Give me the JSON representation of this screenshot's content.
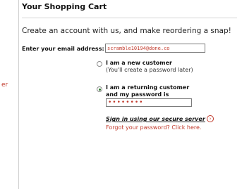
{
  "sidebar": {
    "fragment_text": "er"
  },
  "cart": {
    "title": "Your Shopping Cart",
    "subtitle": "Create an account with us, and make reordering a snap!",
    "email_label": "Enter your email address:",
    "email_value": "scramble10194@done.co",
    "options": {
      "new_customer": {
        "title": "I am a new customer",
        "note": "(You'll create a password later)",
        "selected": false
      },
      "returning_customer": {
        "line1": "I am a returning customer",
        "line2": "and my password is",
        "selected": true,
        "password_mask": "••••••••"
      }
    },
    "signin_link": "Sign in using our secure server",
    "signin_arrow_icon": "arrow-right-circle-icon",
    "forgot_link": "Forgot your password? Click here."
  },
  "colors": {
    "accent_red": "#c0392b",
    "radio_selected": "#2b7a2b"
  }
}
